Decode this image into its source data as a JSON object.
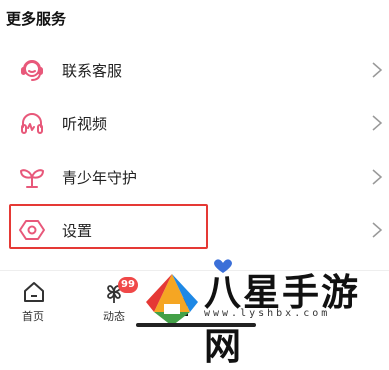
{
  "section": {
    "title": "更多服务"
  },
  "menu": [
    {
      "label": "联系客服",
      "icon": "customer-service-headset-icon"
    },
    {
      "label": "听视频",
      "icon": "headphones-icon"
    },
    {
      "label": "青少年守护",
      "icon": "sprout-icon"
    },
    {
      "label": "设置",
      "icon": "settings-hexagon-icon"
    }
  ],
  "tabbar": {
    "home_label": "首页",
    "feed_label": "动态",
    "feed_badge": "99"
  },
  "watermark": {
    "brand": "八星手游网",
    "url": "www.lyshbx.com"
  },
  "colors": {
    "accent": "#e8587a",
    "highlight": "#e53935",
    "badge": "#f04848"
  }
}
